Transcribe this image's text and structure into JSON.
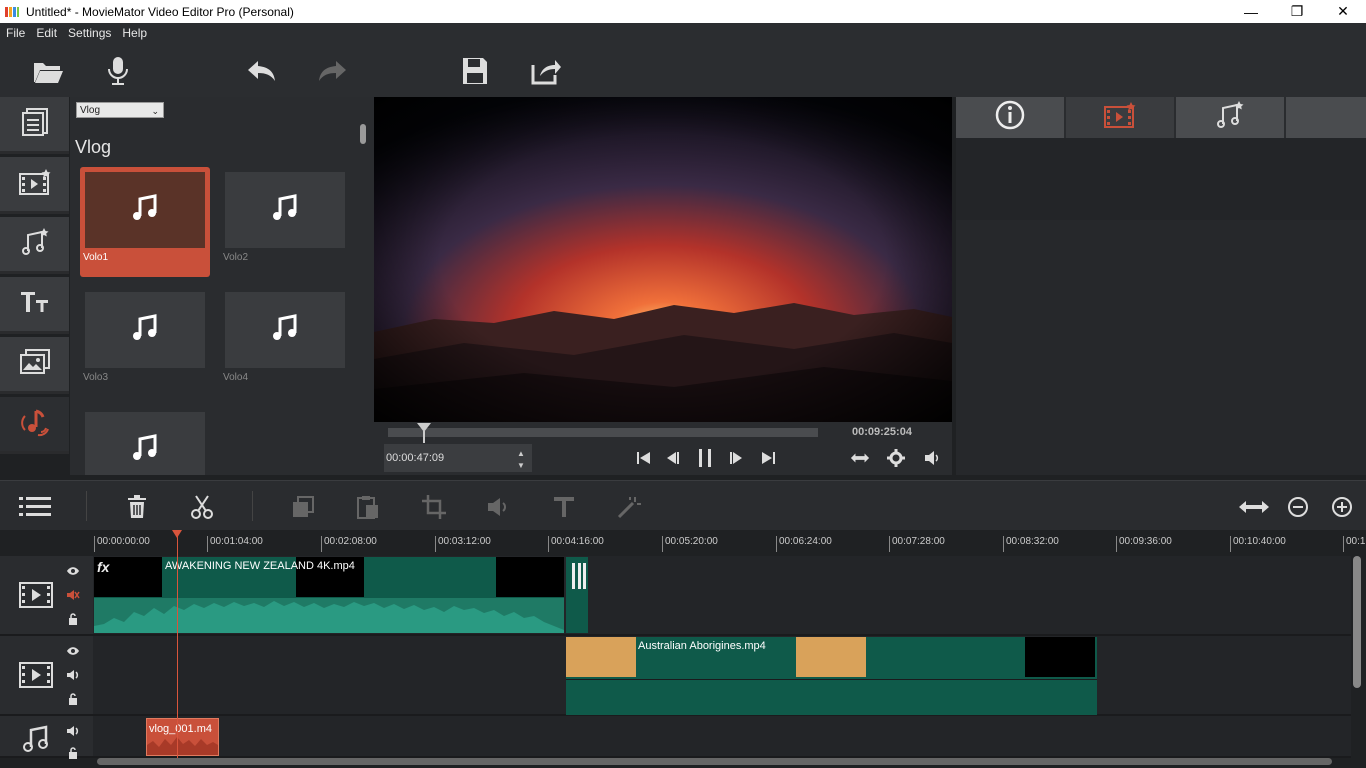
{
  "window": {
    "title": "Untitled* - MovieMator Video Editor Pro (Personal)"
  },
  "menu": [
    "File",
    "Edit",
    "Settings",
    "Help"
  ],
  "library": {
    "category_select": "Vlog",
    "heading": "Vlog",
    "items": [
      "Volo1",
      "Volo2",
      "Volo3",
      "Volo4",
      ""
    ]
  },
  "player": {
    "duration": "00:09:25:04",
    "position": "00:00:47:09"
  },
  "ruler": [
    "00:00:00:00",
    "00:01:04:00",
    "00:02:08:00",
    "00:03:12:00",
    "00:04:16:00",
    "00:05:20:00",
    "00:06:24:00",
    "00:07:28:00",
    "00:08:32:00",
    "00:09:36:00",
    "00:10:40:00",
    "00:1"
  ],
  "tracks": {
    "video1": {
      "fx": "fx",
      "clip": "AWAKENING   NEW ZEALAND 4K.mp4"
    },
    "video2": {
      "clip": "Australian Aborigines.mp4"
    },
    "audio1": {
      "clip": "vlog_001.m4"
    }
  },
  "colors": {
    "accent": "#c9503a",
    "clip_teal": "#0f5a4a",
    "wave": "#2a9a82"
  }
}
